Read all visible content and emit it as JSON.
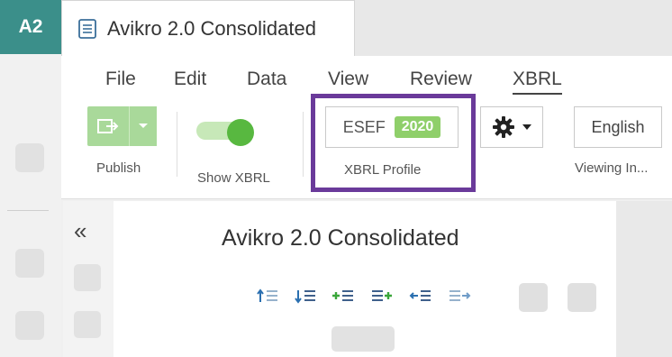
{
  "rail": {
    "badge": "A2"
  },
  "document_tab": {
    "title": "Avikro 2.0 Consolidated",
    "icon": "document-icon"
  },
  "menu": {
    "items": [
      {
        "label": "File"
      },
      {
        "label": "Edit"
      },
      {
        "label": "Data"
      },
      {
        "label": "View"
      },
      {
        "label": "Review"
      },
      {
        "label": "XBRL",
        "active": true
      }
    ]
  },
  "ribbon": {
    "publish_label": "Publish",
    "show_xbrl_label": "Show XBRL",
    "show_xbrl_on": true,
    "xbrl_profile": {
      "standard": "ESEF",
      "year": "2020",
      "label": "XBRL Profile"
    },
    "settings_icon": "gear-icon",
    "viewing_language": {
      "value": "English",
      "label": "Viewing In..."
    }
  },
  "page": {
    "title": "Avikro 2.0 Consolidated",
    "collapse_icon": "double-chevron-left-icon"
  },
  "colors": {
    "accent_teal": "#3b8f8a",
    "publish_green": "#a9d99a",
    "toggle_green": "#58b840",
    "badge_green": "#8fcf6a",
    "highlight_purple": "#6a3a9a",
    "outline_icon_blue": "#2a6fb0",
    "outline_icon_green": "#3aa63a"
  }
}
